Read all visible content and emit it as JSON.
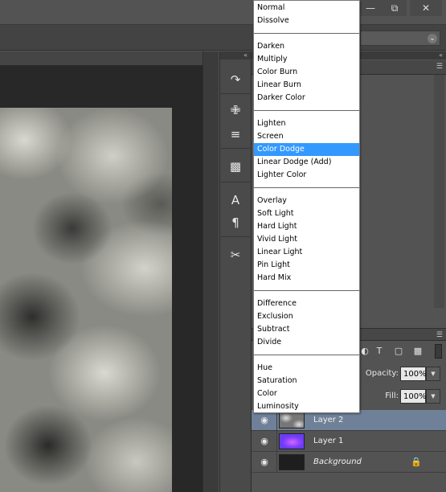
{
  "window": {
    "minimize_icon": "minimize-icon",
    "restore_icon": "restore-icon",
    "close_icon": "close-icon"
  },
  "blend_modes": {
    "groups": [
      [
        "Normal",
        "Dissolve"
      ],
      [
        "Darken",
        "Multiply",
        "Color Burn",
        "Linear Burn",
        "Darker Color"
      ],
      [
        "Lighten",
        "Screen",
        "Color Dodge",
        "Linear Dodge (Add)",
        "Lighter Color"
      ],
      [
        "Overlay",
        "Soft Light",
        "Hard Light",
        "Vivid Light",
        "Linear Light",
        "Pin Light",
        "Hard Mix"
      ],
      [
        "Difference",
        "Exclusion",
        "Subtract",
        "Divide"
      ],
      [
        "Hue",
        "Saturation",
        "Color",
        "Luminosity"
      ]
    ],
    "selected": "Color Dodge"
  },
  "layers_panel": {
    "opacity_label": "Opacity:",
    "opacity_value": "100%",
    "fill_label": "Fill:",
    "fill_value": "100%",
    "layers": [
      {
        "name": "Layer 2",
        "selected": true
      },
      {
        "name": "Layer 1",
        "selected": false
      },
      {
        "name": "Background",
        "selected": false,
        "locked": true
      }
    ]
  },
  "colors": {
    "selection_highlight": "#3399ff",
    "selected_layer": "#6f8198",
    "panel_bg": "#535353"
  }
}
